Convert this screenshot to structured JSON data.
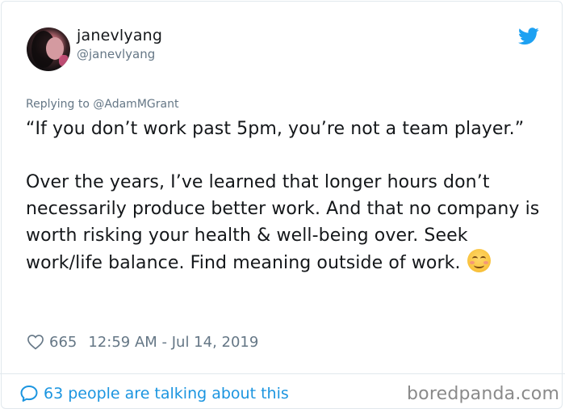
{
  "author": {
    "display_name": "janevlyang",
    "username": "@janevlyang",
    "avatar_icon": "profile-photo"
  },
  "brand": {
    "icon": "twitter-bird-icon",
    "color": "#1da1f2"
  },
  "reply": {
    "text": "Replying to @AdamMGrant"
  },
  "tweet": {
    "line1": "“If you don’t work past 5pm, you’re not a team player.”",
    "line2": "Over the years, I’ve learned that longer hours don’t necessarily produce better work. And that no company is worth risking your health & well-being over. Seek work/life balance. Find meaning outside of work.",
    "emoji": "smiling-face-with-smiling-eyes"
  },
  "meta": {
    "like_icon": "heart-icon",
    "likes": "665",
    "timestamp": "12:59 AM - Jul 14, 2019"
  },
  "footer": {
    "talking_icon": "speech-bubble-icon",
    "talking_text": "63 people are talking about this",
    "link_color": "#1b95e0"
  },
  "watermark": {
    "text": "boredpanda.com"
  }
}
